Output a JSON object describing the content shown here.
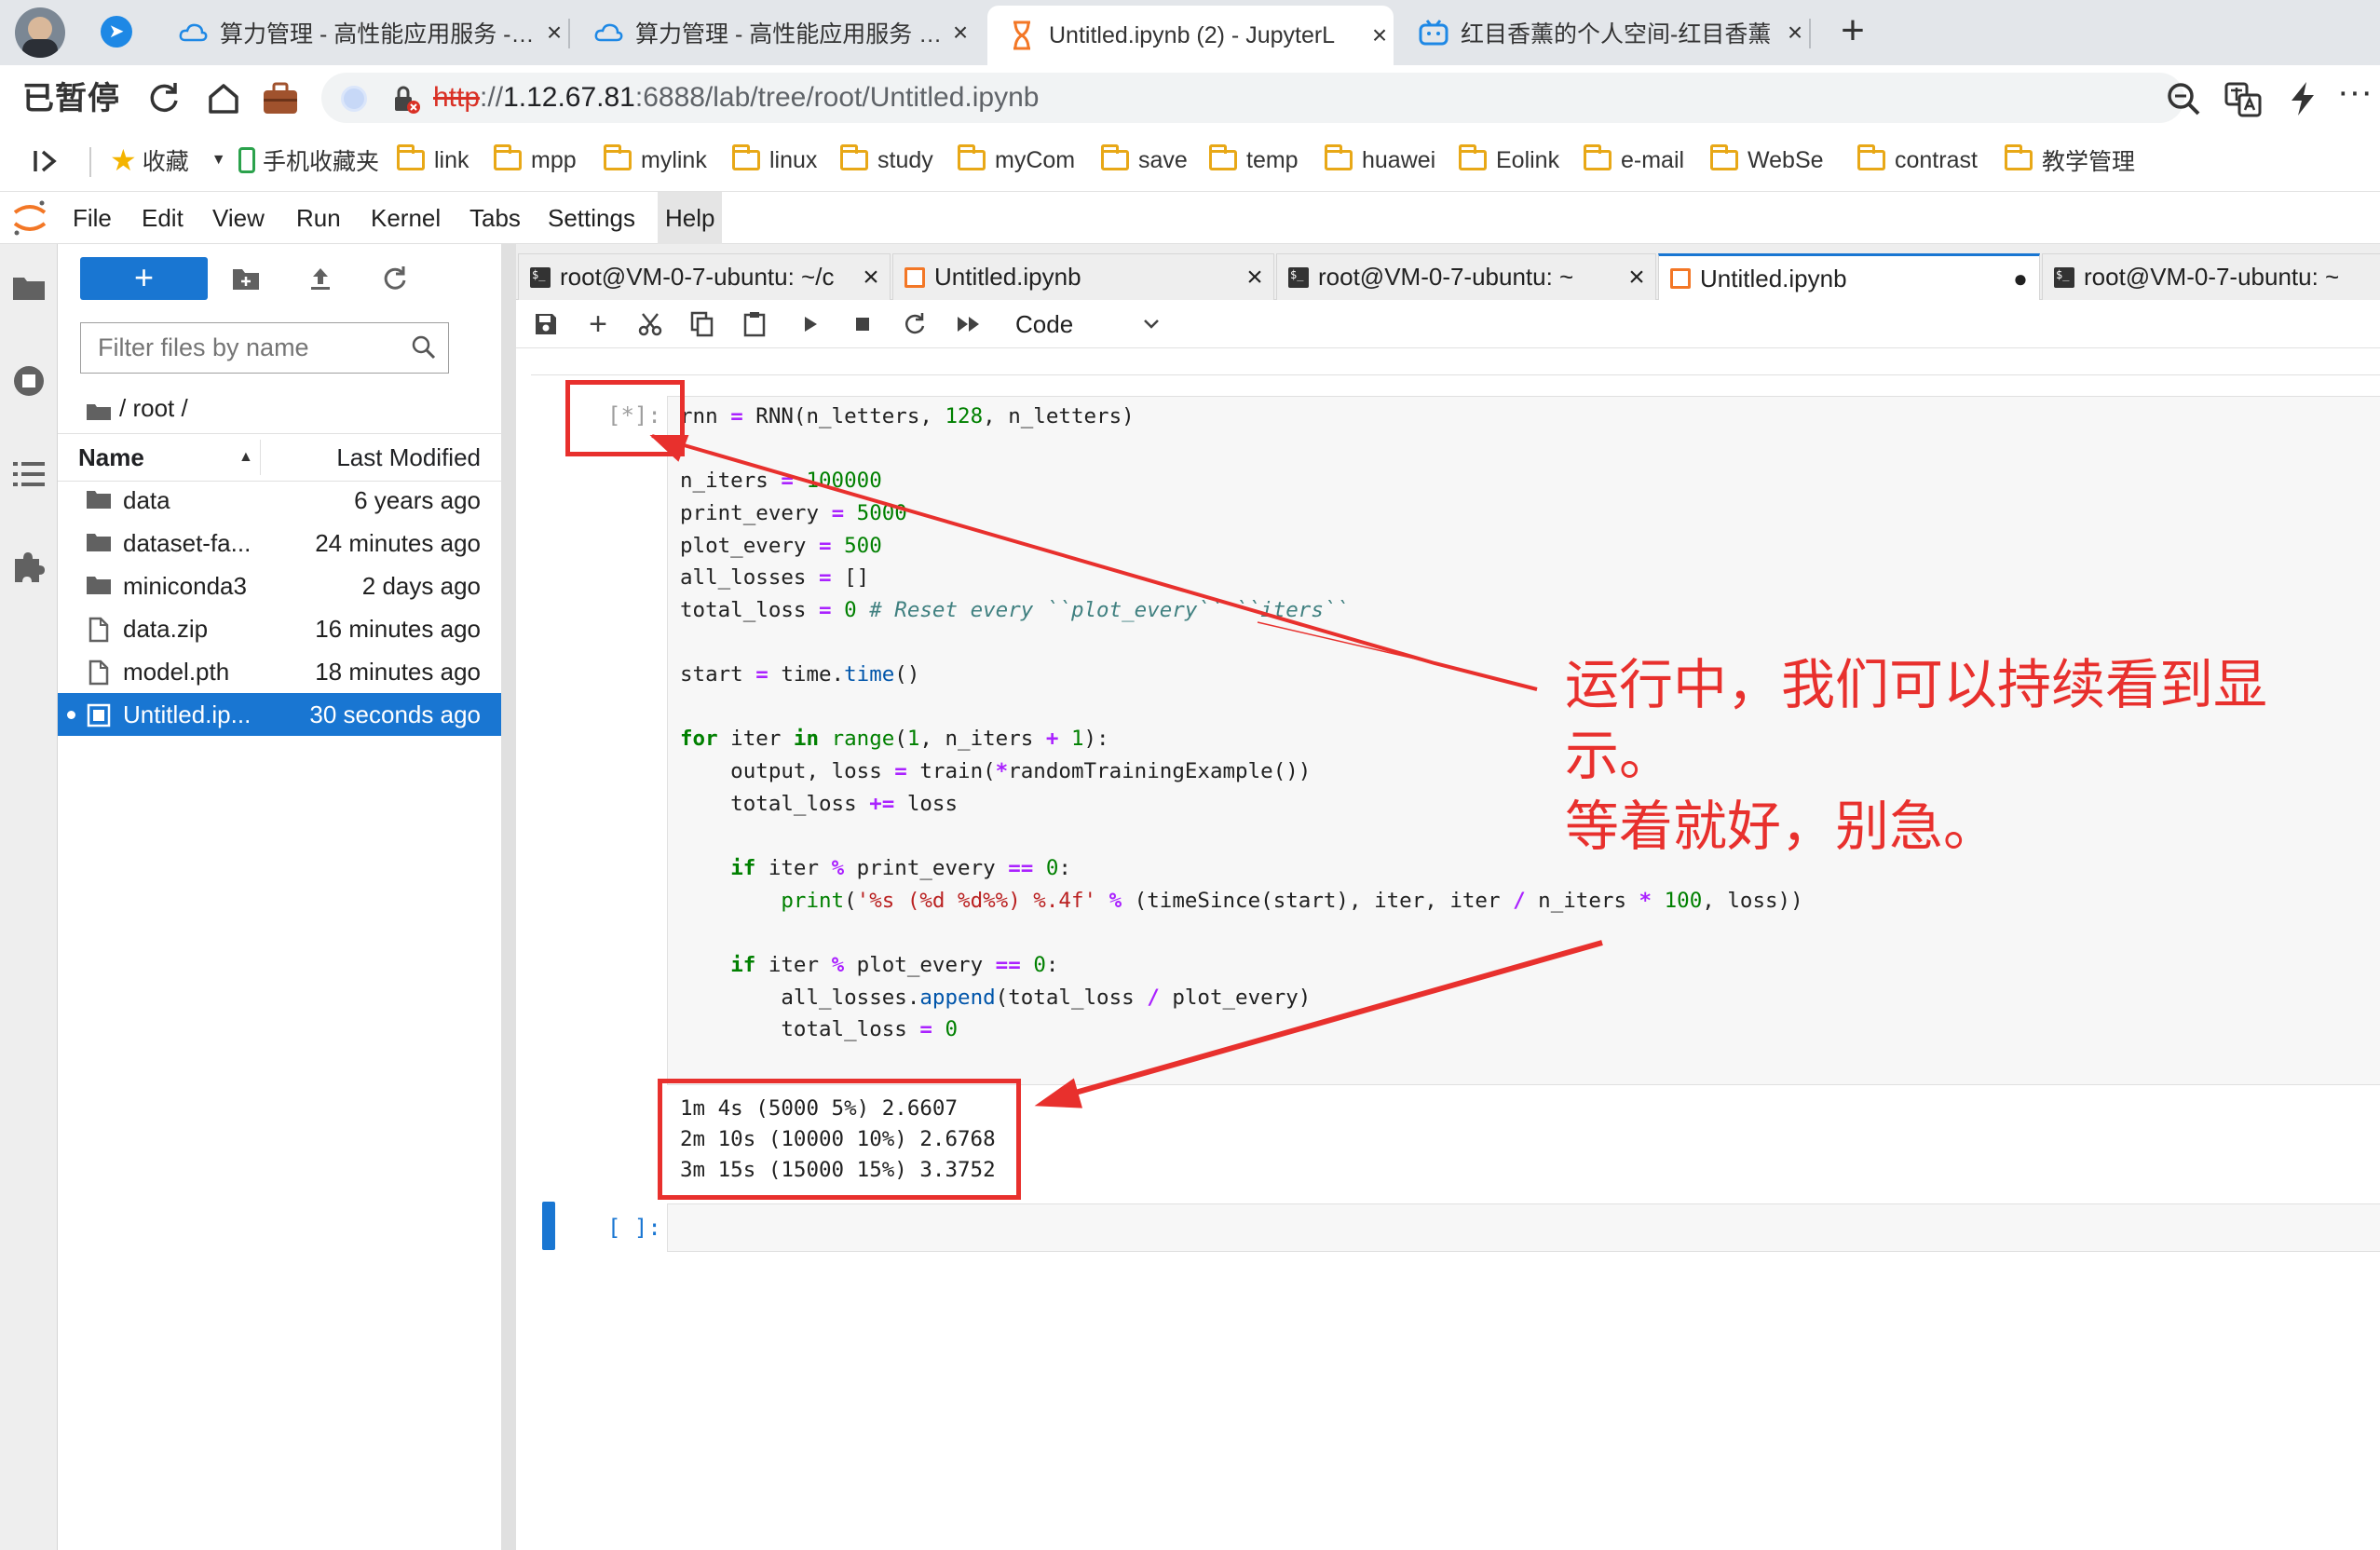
{
  "browser": {
    "tabs": [
      {
        "title": "算力管理 - 高性能应用服务 - 雪",
        "icon": "cloud-icon"
      },
      {
        "title": "算力管理 - 高性能应用服务 - 雪",
        "icon": "cloud-icon"
      },
      {
        "title": "Untitled.ipynb (2) - JupyterL",
        "icon": "hourglass-icon",
        "active": true
      },
      {
        "title": "红目香薰的个人空间-红目香薰",
        "icon": "bilibili-icon"
      }
    ],
    "url": {
      "scheme_struck": "http",
      "sep": "://",
      "host": "1.12.67.81",
      "rest": ":6888/lab/tree/root/Untitled.ipynb"
    },
    "pause_label": "已暂停",
    "bookmarks": [
      "收藏",
      "手机收藏夹",
      "link",
      "mpp",
      "mylink",
      "linux",
      "study",
      "myCom",
      "save",
      "temp",
      "huawei",
      "Eolink",
      "e-mail",
      "WebSe",
      "contrast",
      "教学管理"
    ]
  },
  "jupyter": {
    "menu": [
      "File",
      "Edit",
      "View",
      "Run",
      "Kernel",
      "Tabs",
      "Settings",
      "Help"
    ],
    "filebrowser": {
      "new_label": "+",
      "filter_placeholder": "Filter files by name",
      "breadcrumb": "/ root /",
      "columns": {
        "name": "Name",
        "modified": "Last Modified"
      },
      "files": [
        {
          "name": "data",
          "modified": "6 years ago",
          "type": "folder"
        },
        {
          "name": "dataset-fa...",
          "modified": "24 minutes ago",
          "type": "folder"
        },
        {
          "name": "miniconda3",
          "modified": "2 days ago",
          "type": "folder"
        },
        {
          "name": "data.zip",
          "modified": "16 minutes ago",
          "type": "file"
        },
        {
          "name": "model.pth",
          "modified": "18 minutes ago",
          "type": "file"
        },
        {
          "name": "Untitled.ip...",
          "modified": "30 seconds ago",
          "type": "notebook",
          "selected": true
        }
      ]
    },
    "tabs": [
      {
        "title": "root@VM-0-7-ubuntu: ~/c",
        "type": "terminal"
      },
      {
        "title": "Untitled.ipynb",
        "type": "notebook"
      },
      {
        "title": "root@VM-0-7-ubuntu: ~",
        "type": "terminal"
      },
      {
        "title": "Untitled.ipynb",
        "type": "notebook",
        "active": true
      },
      {
        "title": "root@VM-0-7-ubuntu: ~",
        "type": "terminal"
      }
    ],
    "toolbar": {
      "cell_type": "Code"
    },
    "cells": [
      {
        "prompt": "[*]:"
      },
      {
        "prompt": "[ ]:"
      }
    ],
    "output": [
      "1m 4s (5000 5%) 2.6607",
      "2m 10s (10000 10%) 2.6768",
      "3m 15s (15000 15%) 3.3752"
    ]
  },
  "annotation": {
    "line1": "运行中，我们可以持续看到显示。",
    "line2": "等着就好，别急。",
    "color": "#e8302d"
  }
}
